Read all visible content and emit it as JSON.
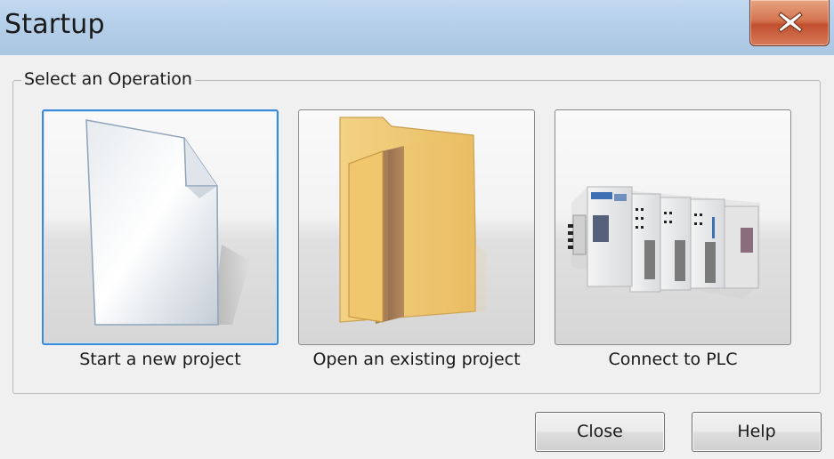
{
  "window": {
    "title": "Startup",
    "close_icon": "close-x-icon"
  },
  "group": {
    "legend": "Select an Operation"
  },
  "operations": [
    {
      "label": "Start a new project",
      "icon": "new-document-icon",
      "selected": true
    },
    {
      "label": "Open an existing project",
      "icon": "open-folder-icon",
      "selected": false
    },
    {
      "label": "Connect to PLC",
      "icon": "plc-hardware-icon",
      "selected": false
    }
  ],
  "buttons": {
    "close_label": "Close",
    "help_label": "Help"
  },
  "colors": {
    "titlebar": "#b5cfe9",
    "close_button": "#c0502f",
    "selection_border": "#3b8bd8",
    "folder": "#f1c76e"
  }
}
